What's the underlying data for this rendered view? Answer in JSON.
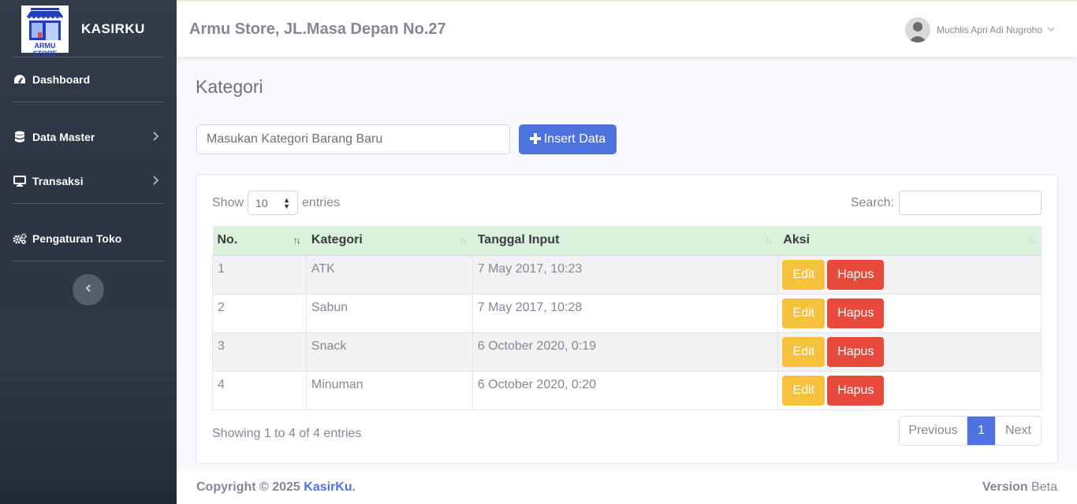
{
  "sidebar": {
    "brand": "KASIRKU",
    "logo_text": "ARMU STORE",
    "logo_small_text": "TOKO SERBA ADA",
    "items": [
      {
        "label": "Dashboard",
        "icon": "tachometer-icon"
      },
      {
        "label": "Data Master",
        "icon": "database-icon"
      },
      {
        "label": "Transaksi",
        "icon": "desktop-icon"
      },
      {
        "label": "Pengaturan Toko",
        "icon": "cogs-icon"
      }
    ],
    "toggle_icon": "chevron-left-icon"
  },
  "topbar": {
    "store_title": "Armu Store, JL.Masa Depan No.27",
    "user_name": "Muchlis Apri Adi Nugroho"
  },
  "page": {
    "title": "Kategori",
    "input_placeholder": "Masukan Kategori Barang Baru",
    "insert_label": "Insert Data"
  },
  "table_controls": {
    "show_label": "Show",
    "entries_value": "10",
    "entries_label": "entries",
    "search_label": "Search:"
  },
  "table": {
    "columns": [
      "No.",
      "Kategori",
      "Tanggal Input",
      "Aksi"
    ],
    "rows": [
      {
        "no": "1",
        "kategori": "ATK",
        "tanggal": "7 May 2017, 10:23"
      },
      {
        "no": "2",
        "kategori": "Sabun",
        "tanggal": "7 May 2017, 10:28"
      },
      {
        "no": "3",
        "kategori": "Snack",
        "tanggal": "6 October 2020, 0:19"
      },
      {
        "no": "4",
        "kategori": "Minuman",
        "tanggal": "6 October 2020, 0:20"
      }
    ],
    "edit_label": "Edit",
    "delete_label": "Hapus"
  },
  "pagination": {
    "info": "Showing 1 to 4 of 4 entries",
    "previous": "Previous",
    "current": "1",
    "next": "Next"
  },
  "footer": {
    "copyright_prefix": "Copyright © 2025 ",
    "brand": "KasirKu",
    "copyright_suffix": ".",
    "version_label": "Version",
    "version_value": "Beta"
  },
  "colors": {
    "primary": "#4e73df",
    "warning": "#f6c23e",
    "danger": "#e74a3b",
    "table_header": "#d9f2d9"
  }
}
